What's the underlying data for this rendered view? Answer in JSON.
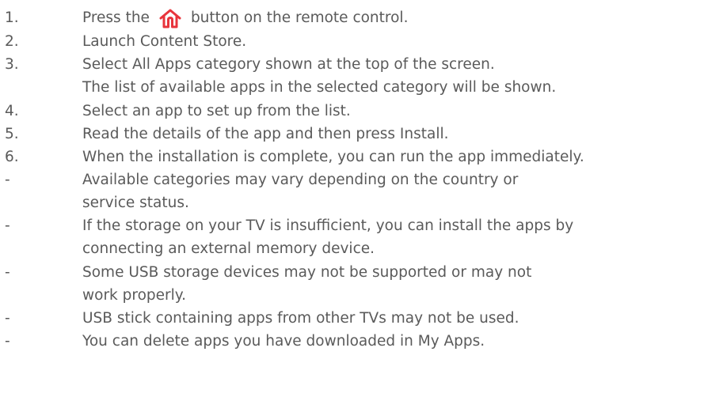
{
  "steps": [
    {
      "marker": "1.",
      "before": "Press the",
      "icon": "home-icon",
      "after": "button on the remote control."
    },
    {
      "marker": "2.",
      "text": "Launch Content Store."
    },
    {
      "marker": "3.",
      "text": "Select All Apps category shown at the top of the screen."
    },
    {
      "marker": "",
      "text": "The list of available apps in the selected category will be shown."
    },
    {
      "marker": "4.",
      "text": "Select an app to set up from the list."
    },
    {
      "marker": "5.",
      "text": "Read the details of the app and then press Install."
    },
    {
      "marker": "6.",
      "text": "When the installation is complete, you can run the app immediately."
    }
  ],
  "notes": [
    {
      "marker": "-",
      "text": "Available categories may vary depending on the country or"
    },
    {
      "marker": "",
      "text": "service status."
    },
    {
      "marker": "-",
      "text": "If the storage on your TV is insufficient, you can install the apps by"
    },
    {
      "marker": "",
      "text": "connecting an external memory device."
    },
    {
      "marker": "-",
      "text": "Some USB storage devices may not be supported or may not"
    },
    {
      "marker": "",
      "text": "work properly."
    },
    {
      "marker": "-",
      "text": "USB stick containing apps from other TVs may not be used."
    },
    {
      "marker": "-",
      "text": "You can delete apps you have downloaded in My Apps."
    }
  ],
  "colors": {
    "text": "#5a5a5a",
    "icon_accent": "#e8343c"
  }
}
